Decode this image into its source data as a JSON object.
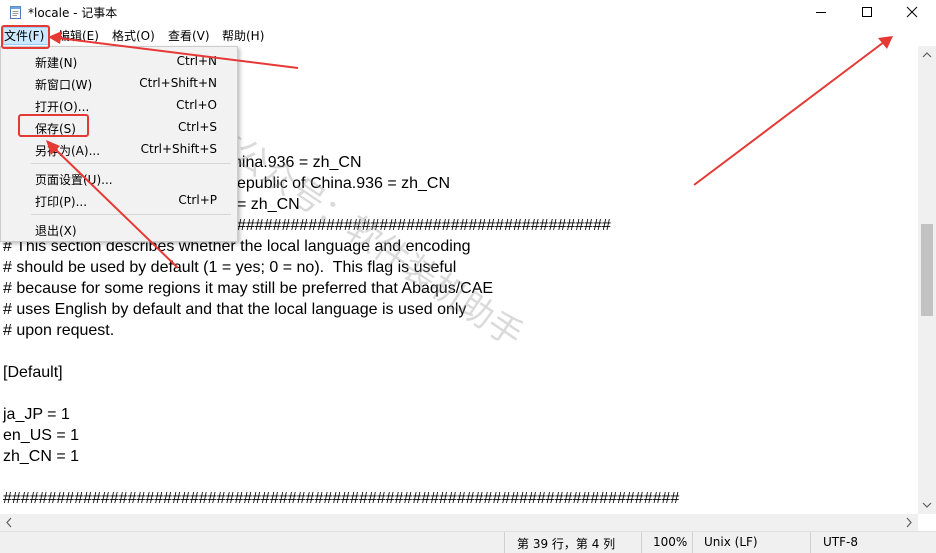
{
  "window": {
    "title": "*locale - 记事本",
    "minimize_icon": "minimize-icon",
    "maximize_icon": "maximize-icon",
    "close_icon": "close-icon"
  },
  "menubar": {
    "items": [
      {
        "label": "文件(F)"
      },
      {
        "label": "编辑(E)"
      },
      {
        "label": "格式(O)"
      },
      {
        "label": "查看(V)"
      },
      {
        "label": "帮助(H)"
      }
    ]
  },
  "file_menu": {
    "items": [
      {
        "label": "新建(N)",
        "shortcut": "Ctrl+N"
      },
      {
        "label": "新窗口(W)",
        "shortcut": "Ctrl+Shift+N"
      },
      {
        "label": "打开(O)...",
        "shortcut": "Ctrl+O"
      },
      {
        "label": "保存(S)",
        "shortcut": "Ctrl+S"
      },
      {
        "label": "另存为(A)...",
        "shortcut": "Ctrl+Shift+S"
      },
      {
        "label": "页面设置(U)...",
        "shortcut": ""
      },
      {
        "label": "打印(P)...",
        "shortcut": "Ctrl+P"
      },
      {
        "label": "退出(X)",
        "shortcut": ""
      }
    ]
  },
  "editor": {
    "lines": [
      "hina.936 = zh_CN",
      "epublic of China.936 = zh_CN",
      "= zh_CN",
      "##########################################",
      "# This section describes whether the local language and encoding",
      "# should be used by default (1 = yes; 0 = no).  This flag is useful",
      "# because for some regions it may still be preferred that Abaqus/CAE",
      "# uses English by default and that the local language is used only",
      "# upon request.",
      "",
      "[Default]",
      "",
      "ja_JP = 1",
      "en_US = 1",
      "zh_CN = 1",
      "",
      "############################################################################"
    ]
  },
  "statusbar": {
    "position": "第 39 行，第 4 列",
    "zoom": "100%",
    "line_ending": "Unix (LF)",
    "encoding": "UTF-8"
  },
  "watermark": {
    "text": "微信公众号：软件装机助手"
  },
  "colors": {
    "annotation_red": "#e53935",
    "menu_highlight": "#cce8ff"
  }
}
